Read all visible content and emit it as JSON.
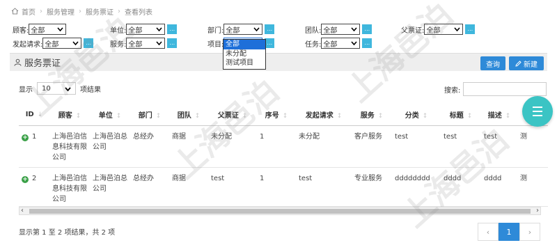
{
  "breadcrumb": [
    "首页",
    "服务管理",
    "服务票证",
    "查看列表"
  ],
  "filters": {
    "customer": {
      "label": "顾客:",
      "value": "全部"
    },
    "unit": {
      "label": "单位:",
      "value": "全部"
    },
    "dept": {
      "label": "部门:",
      "value": "全部"
    },
    "team": {
      "label": "团队:",
      "value": "全部"
    },
    "parent_ticket": {
      "label": "父票证:",
      "value": "全部"
    },
    "initiate_request": {
      "label": "发起请求:",
      "value": "全部"
    },
    "service": {
      "label": "服务:",
      "value": "全部"
    },
    "project": {
      "label": "项目:",
      "value": "全部"
    },
    "task": {
      "label": "任务:",
      "value": "全部"
    },
    "lookup_button": "..."
  },
  "project_dropdown": [
    "全部",
    "未分配",
    "测试项目"
  ],
  "panel": {
    "title": "服务票证",
    "query_label": "查询",
    "new_label": "新建"
  },
  "length": {
    "prefix": "显示",
    "value": "10",
    "suffix": "项结果"
  },
  "search": {
    "label": "搜索:"
  },
  "table": {
    "headers": [
      "ID",
      "顾客",
      "单位",
      "部门",
      "团队",
      "父票证",
      "序号",
      "发起请求",
      "服务",
      "分类",
      "标题",
      "描述",
      "测"
    ],
    "rows": [
      {
        "id": "1",
        "customer": "上海邑泊信息科技有限公司",
        "unit": "上海邑泊总公司",
        "dept": "总经办",
        "team": "商据",
        "parent": "未分配",
        "seq": "1",
        "request": "未分配",
        "service": "客户服务",
        "category": "test",
        "title": "test",
        "desc": "test",
        "extra": "测"
      },
      {
        "id": "2",
        "customer": "上海邑泊信息科技有限公司",
        "unit": "上海邑泊总公司",
        "dept": "总经办",
        "team": "商据",
        "parent": "test",
        "seq": "1",
        "request": "test",
        "service": "专业服务",
        "category": "dddddddd",
        "title": "dddd",
        "desc": "dddd",
        "extra": "测"
      }
    ]
  },
  "info": "显示第 1 至 2 项结果，共 2 项",
  "pager": {
    "prev": "‹",
    "current": "1",
    "next": "›"
  },
  "watermark": "上海邑泊",
  "colors": {
    "accent": "#2e8ad8",
    "lookup": "#3fb7dd",
    "fab": "#3bc4c4",
    "plus": "#3aa047"
  }
}
